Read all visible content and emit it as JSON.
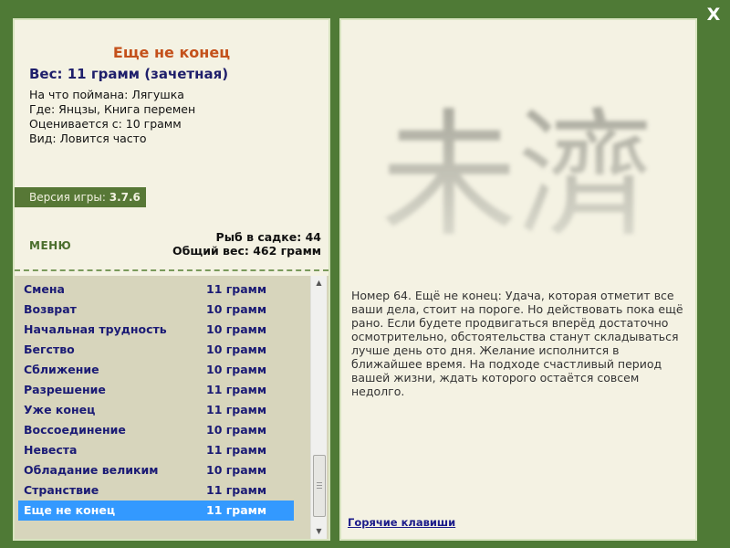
{
  "window": {
    "close_label": "X"
  },
  "fish": {
    "title": "Еще не конец",
    "weight_line": "Вес: 11 грамм (зачетная)",
    "caught_with": "На что поймана: Лягушка",
    "location": "Где: Янцзы, Книга перемен",
    "rated_from": "Оценивается с: 10 грамм",
    "kind": "Вид: Ловится часто"
  },
  "version": {
    "label": "Версия игры:",
    "number": "3.7.6"
  },
  "menu_label": "МЕНЮ",
  "stats": {
    "fish_count": "Рыб в садке: 44",
    "total_weight": "Общий вес: 462 грамм"
  },
  "fish_list": [
    {
      "name": "Смена",
      "weight": "11 грамм"
    },
    {
      "name": "Возврат",
      "weight": "10 грамм"
    },
    {
      "name": "Начальная трудность",
      "weight": "10 грамм"
    },
    {
      "name": "Бегство",
      "weight": "10 грамм"
    },
    {
      "name": "Сближение",
      "weight": "10 грамм"
    },
    {
      "name": "Разрешение",
      "weight": "11 грамм"
    },
    {
      "name": "Уже конец",
      "weight": "11 грамм"
    },
    {
      "name": "Воссоединение",
      "weight": "10 грамм"
    },
    {
      "name": "Невеста",
      "weight": "11 грамм"
    },
    {
      "name": "Обладание великим",
      "weight": "10 грамм"
    },
    {
      "name": "Странствие",
      "weight": "11 грамм"
    },
    {
      "name": "Еще не конец",
      "weight": "11 грамм"
    }
  ],
  "selected_index": 11,
  "hexagram": {
    "chars": "未濟"
  },
  "description": "Номер 64. Ещё не конец: Удача, которая отметит все ваши дела, стоит на пороге. Но действовать пока ещё рано. Если будете продвигаться вперёд достаточно осмотрительно, обстоятельства станут складываться лучше день ото дня. Желание исполнится в ближайшее время. На подходе счастливый период вашей жизни, ждать которого остаётся совсем недолго.",
  "hotkeys_label": "Горячие клавиши",
  "colors": {
    "background": "#4f7a36",
    "panel": "#f4f2e3",
    "list_bg": "#d7d5bc",
    "selection": "#3399ff",
    "title": "#c4511b",
    "list_text": "#1b1b75"
  }
}
